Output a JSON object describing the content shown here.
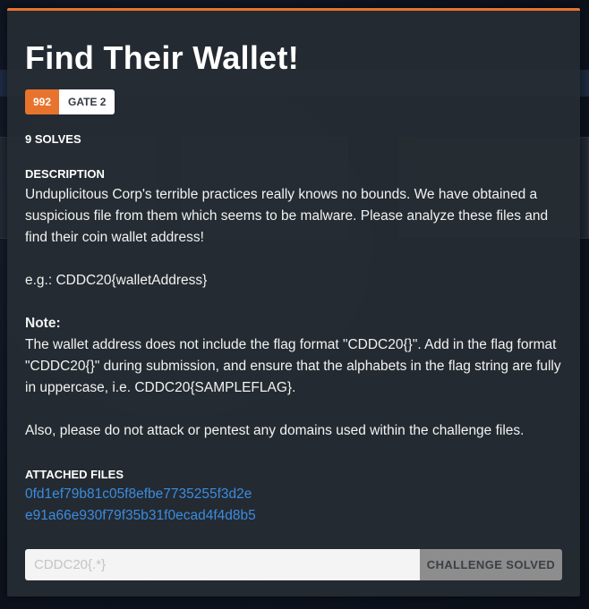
{
  "challenge": {
    "title": "Find Their Wallet!",
    "points": "992",
    "gate": "GATE 2",
    "solves": "9 SOLVES"
  },
  "description": {
    "label": "DESCRIPTION",
    "paragraph1": "Unduplicitous Corp's terrible practices really knows no bounds. We have obtained a suspicious file from them which seems to be malware. Please analyze these files and find their coin wallet address!",
    "example": "e.g.: CDDC20{walletAddress}",
    "note_heading": "Note:",
    "note_body": "The wallet address does not include the flag format \"CDDC20{}\". Add in the flag format \"CDDC20{}\" during submission, and ensure that the alphabets in the flag string are fully in uppercase, i.e. CDDC20{SAMPLEFLAG}.",
    "warning": "Also, please do not attack or pentest any domains used within the challenge files."
  },
  "attachments": {
    "label": "ATTACHED FILES",
    "files": [
      "0fd1ef79b81c05f8efbe7735255f3d2e",
      "e91a66e930f79f35b31f0ecad4f4d8b5"
    ]
  },
  "submission": {
    "placeholder": "CDDC20{.*}",
    "value": "",
    "button_label": "CHALLENGE SOLVED"
  },
  "colors": {
    "accent": "#e8732c",
    "link": "#3b8ce0",
    "solved_button": "#8d8d8d"
  }
}
